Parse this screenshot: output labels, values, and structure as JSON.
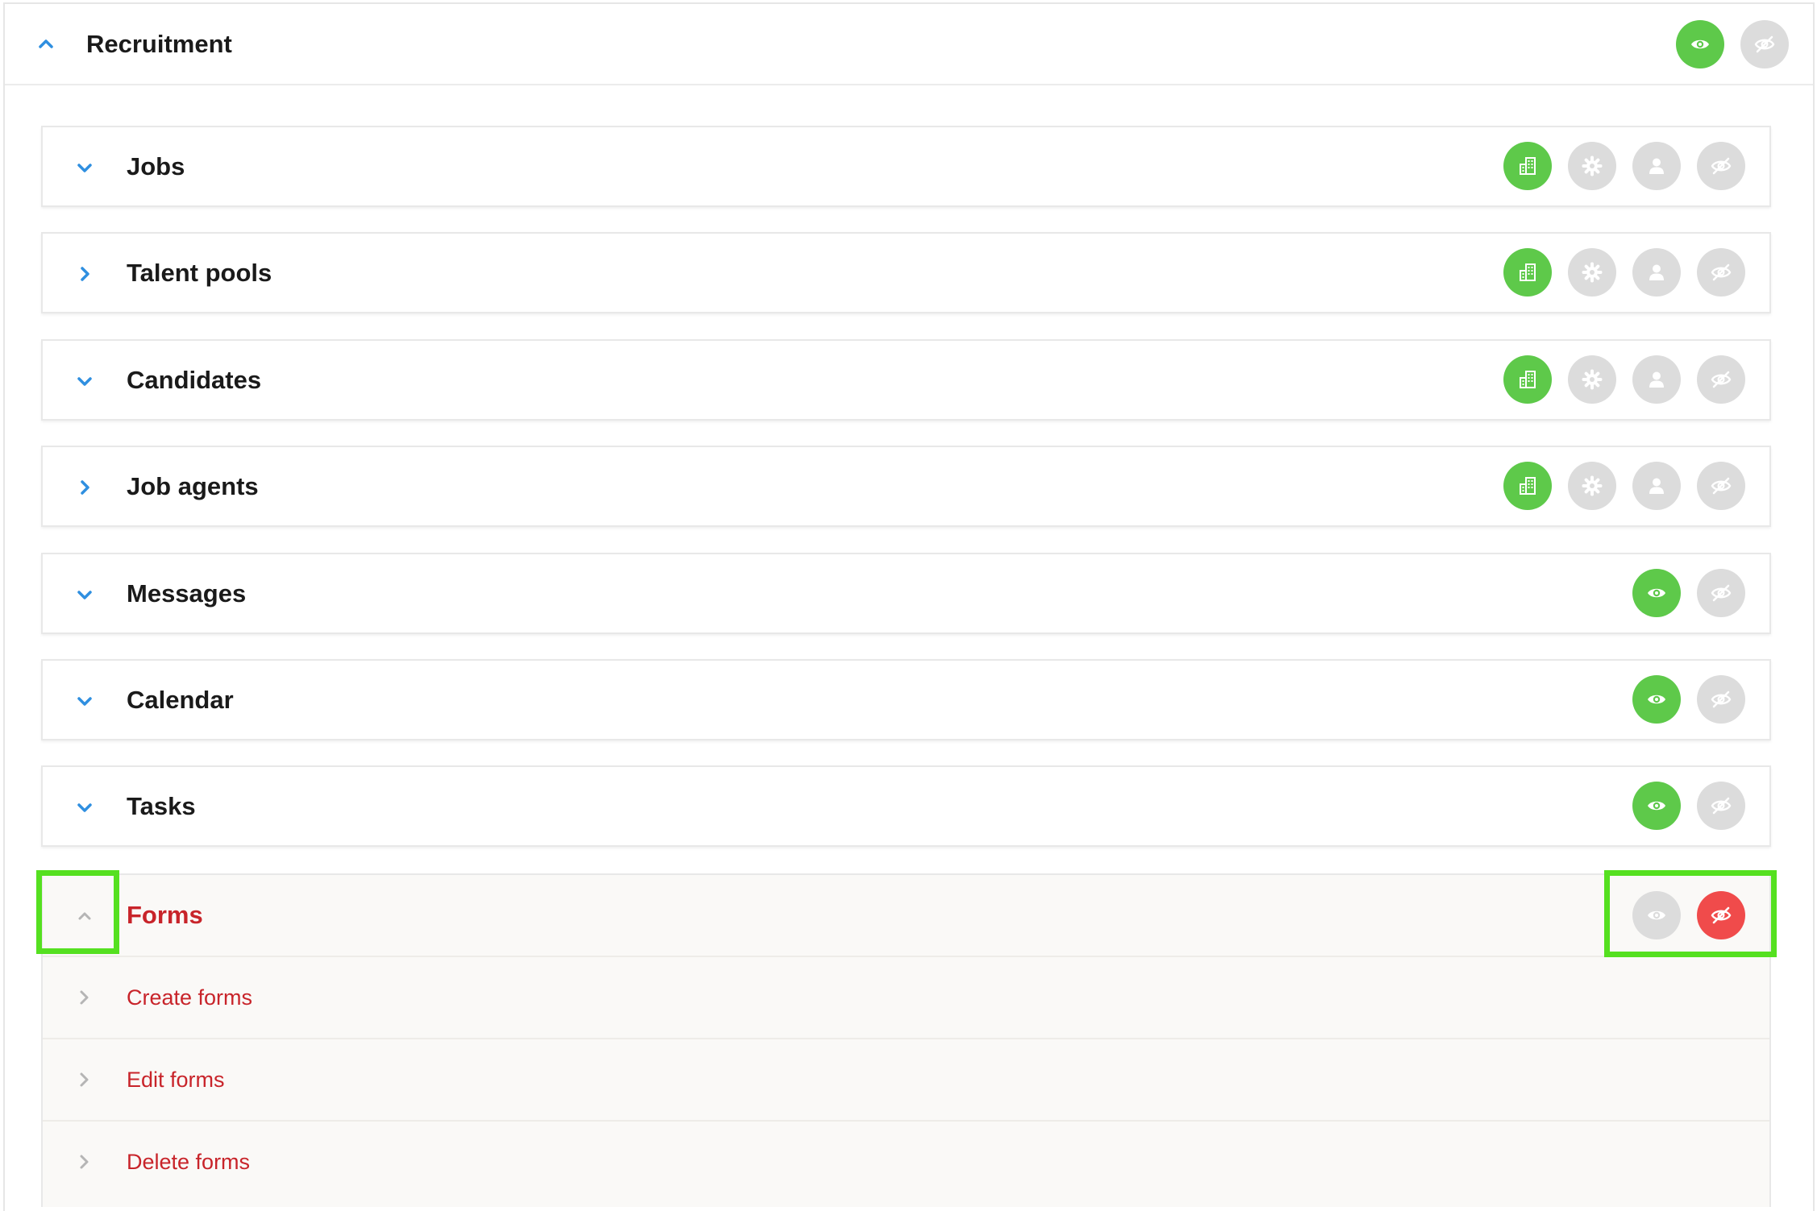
{
  "section": {
    "title": "Recruitment",
    "expanded": true,
    "actions": [
      {
        "icon": "eye-icon",
        "state": "on"
      },
      {
        "icon": "eye-off-icon",
        "state": "off"
      }
    ]
  },
  "modules": [
    {
      "label": "Jobs",
      "chevron": "chevron-down-icon",
      "actions": [
        "building-icon:on",
        "gear-icon:off",
        "person-icon:off",
        "eye-off-icon:off"
      ]
    },
    {
      "label": "Talent pools",
      "chevron": "chevron-right-icon",
      "actions": [
        "building-icon:on",
        "gear-icon:off",
        "person-icon:off",
        "eye-off-icon:off"
      ]
    },
    {
      "label": "Candidates",
      "chevron": "chevron-down-icon",
      "actions": [
        "building-icon:on",
        "gear-icon:off",
        "person-icon:off",
        "eye-off-icon:off"
      ]
    },
    {
      "label": "Job agents",
      "chevron": "chevron-right-icon",
      "actions": [
        "building-icon:on",
        "gear-icon:off",
        "person-icon:off",
        "eye-off-icon:off"
      ]
    },
    {
      "label": "Messages",
      "chevron": "chevron-down-icon",
      "actions": [
        "eye-icon:on",
        "eye-off-icon:off"
      ]
    },
    {
      "label": "Calendar",
      "chevron": "chevron-down-icon",
      "actions": [
        "eye-icon:on",
        "eye-off-icon:off"
      ]
    },
    {
      "label": "Tasks",
      "chevron": "chevron-down-icon",
      "actions": [
        "eye-icon:on",
        "eye-off-icon:off"
      ]
    }
  ],
  "forms": {
    "label": "Forms",
    "chevron": "chevron-up-icon",
    "actions": [
      "eye-icon:off",
      "eye-off-icon:red"
    ],
    "items": [
      {
        "label": "Create forms"
      },
      {
        "label": "Edit forms"
      },
      {
        "label": "Delete forms"
      }
    ]
  },
  "colors": {
    "accent_blue": "#2f8fe0",
    "on_green": "#5ec94a",
    "off_grey": "#dcdcdc",
    "denied_red": "#f04b4b",
    "forms_text_red": "#c8242a",
    "highlight_green": "#55e020"
  }
}
